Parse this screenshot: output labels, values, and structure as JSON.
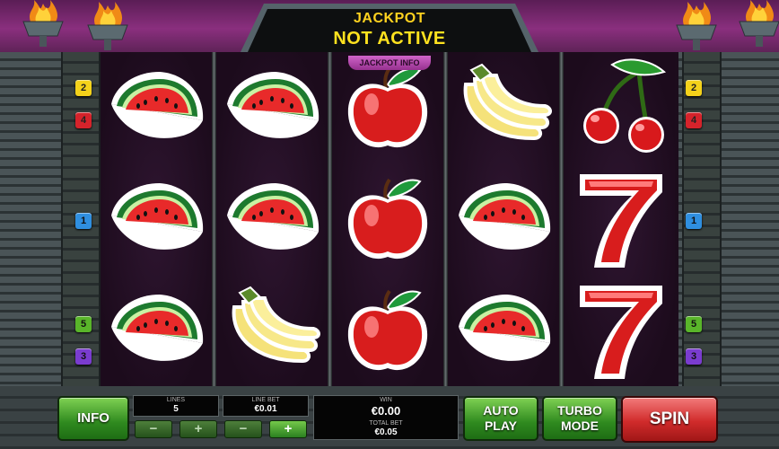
{
  "jackpot": {
    "title": "JACKPOT",
    "status": "NOT ACTIVE",
    "info_label": "JACKPOT INFO"
  },
  "paylines": {
    "left": [
      "2",
      "4",
      "1",
      "5",
      "3"
    ],
    "right": [
      "2",
      "4",
      "1",
      "5",
      "3"
    ]
  },
  "reels": [
    [
      "watermelon",
      "watermelon",
      "watermelon"
    ],
    [
      "watermelon",
      "watermelon",
      "banana"
    ],
    [
      "apple",
      "apple",
      "apple"
    ],
    [
      "banana",
      "watermelon",
      "watermelon"
    ],
    [
      "cherry",
      "seven",
      "seven"
    ]
  ],
  "controls": {
    "info_label": "INFO",
    "lines_caption": "LINES",
    "lines_value": "5",
    "line_bet_caption": "LINE BET",
    "line_bet_value": "€0.01",
    "minus_label": "−",
    "plus_label": "+",
    "win_caption": "WIN",
    "win_value": "€0.00",
    "total_bet_caption": "TOTAL BET",
    "total_bet_value": "€0.05",
    "autoplay_line1": "AUTO",
    "autoplay_line2": "PLAY",
    "turbo_line1": "TURBO",
    "turbo_line2": "MODE",
    "spin_label": "SPIN"
  },
  "colors": {
    "jackpot_text": "#ffd21f",
    "button_green": "#2f8a1f",
    "spin_red": "#d12b2b",
    "reel_background": "#1c0b1c",
    "top_band": "#8a2f7e"
  }
}
